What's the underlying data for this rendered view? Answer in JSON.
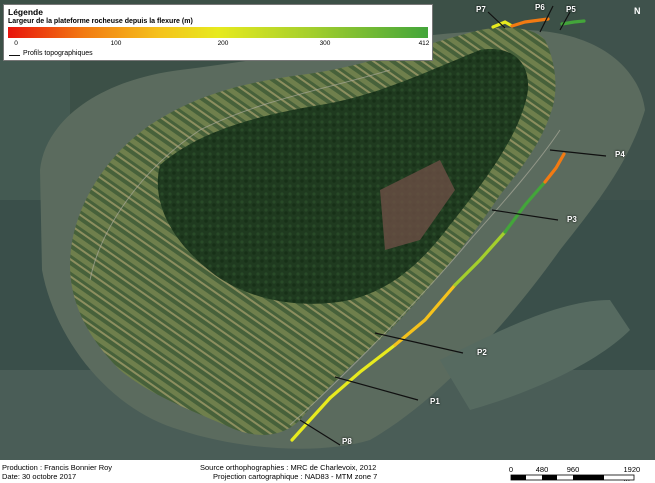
{
  "legend": {
    "title": "Légende",
    "subtitle": "Largeur de la plateforme rocheuse depuis la flexure (m)",
    "ramp_ticks": [
      "0",
      "100",
      "200",
      "300",
      "412"
    ],
    "line_label": "Profils topographiques",
    "ramp_colors": [
      "#e8140c",
      "#f27a12",
      "#f5c21c",
      "#e7ea1e",
      "#a4cf2c",
      "#43a53a"
    ]
  },
  "profiles": [
    "P1",
    "P2",
    "P3",
    "P4",
    "P5",
    "P6",
    "P7",
    "P8"
  ],
  "north_arrow": {
    "letter": "N",
    "icon": "north-arrow-icon"
  },
  "footer": {
    "production": "Production : Francis Bonnier Roy",
    "date": "Date: 30 octobre 2017",
    "source": "Source orthophographies : MRC de Charlevoix, 2012",
    "projection": "Projection cartographique : NAD83 - MTM zone 7",
    "scale_labels": [
      "0",
      "480",
      "960",
      "1920 m"
    ]
  }
}
